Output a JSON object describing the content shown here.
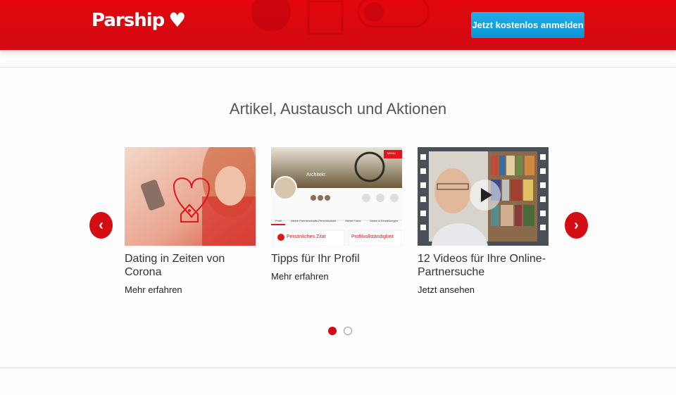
{
  "header": {
    "logo_text": "Parship",
    "logo_heart": "♥",
    "cta_label": "Jetzt kostenlos anmelden"
  },
  "section": {
    "title": "Artikel, Austausch und Aktionen"
  },
  "carousel": {
    "prev_icon": "‹",
    "next_icon": "›",
    "cards": [
      {
        "title": "Dating in Zeiten von Corona",
        "link": "Mehr erfahren"
      },
      {
        "title": "Tipps für Ihr Profil",
        "link": "Mehr erfahren",
        "thumb_name": "Architekt",
        "thumb_menu": "MENÜ",
        "thumb_quote": "Persönliches Zitat",
        "thumb_complete": "Profilvollständigkeit",
        "thumb_tabs": [
          "Profil",
          "Meine Partnerschafts-Persönlichkeit",
          "Meine Fotos",
          "Daten & Einstellungen"
        ]
      },
      {
        "title": "12 Videos für Ihre Online-Partnersuche",
        "link": "Jetzt ansehen"
      }
    ],
    "pagination": {
      "active_index": 0,
      "count": 2
    }
  },
  "colors": {
    "brand_red": "#d20a11",
    "cta_blue": "#1aa3e0"
  }
}
